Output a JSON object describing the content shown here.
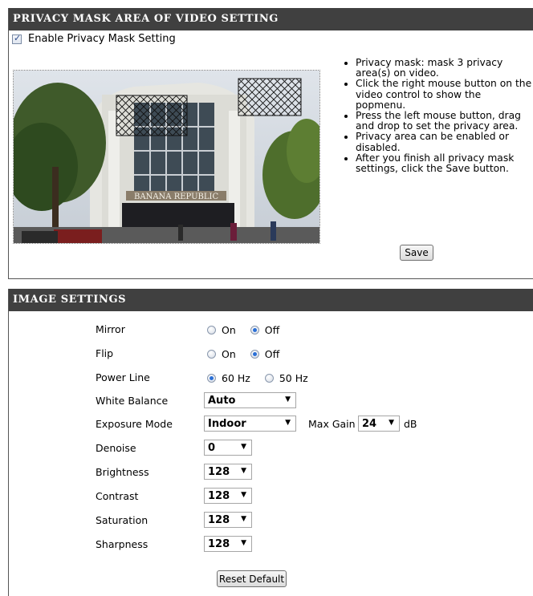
{
  "privacy": {
    "header": "PRIVACY MASK AREA OF VIDEO SETTING",
    "enable_label": "Enable Privacy Mask Setting",
    "enable_checked": true,
    "bullets": [
      "Privacy mask: mask 3 privacy area(s) on video.",
      "Click the right mouse button on the video control to show the popmenu.",
      "Press the left mouse button, drag and drop to set the privacy area.",
      "Privacy area can be enabled or disabled.",
      "After you finish all privacy mask settings, click the Save button."
    ],
    "save_label": "Save",
    "video_sign": "BANANA REPUBLIC"
  },
  "image_settings": {
    "header": "IMAGE SETTINGS",
    "mirror": {
      "label": "Mirror",
      "options": [
        "On",
        "Off"
      ],
      "selected": "Off"
    },
    "flip": {
      "label": "Flip",
      "options": [
        "On",
        "Off"
      ],
      "selected": "Off"
    },
    "power_line": {
      "label": "Power Line",
      "options": [
        "60 Hz",
        "50 Hz"
      ],
      "selected": "60 Hz"
    },
    "white_balance": {
      "label": "White Balance",
      "value": "Auto"
    },
    "exposure_mode": {
      "label": "Exposure Mode",
      "value": "Indoor",
      "max_gain_label": "Max Gain",
      "max_gain_value": "24",
      "unit": "dB"
    },
    "denoise": {
      "label": "Denoise",
      "value": "0"
    },
    "brightness": {
      "label": "Brightness",
      "value": "128"
    },
    "contrast": {
      "label": "Contrast",
      "value": "128"
    },
    "saturation": {
      "label": "Saturation",
      "value": "128"
    },
    "sharpness": {
      "label": "Sharpness",
      "value": "128"
    },
    "reset_label": "Reset Default"
  }
}
